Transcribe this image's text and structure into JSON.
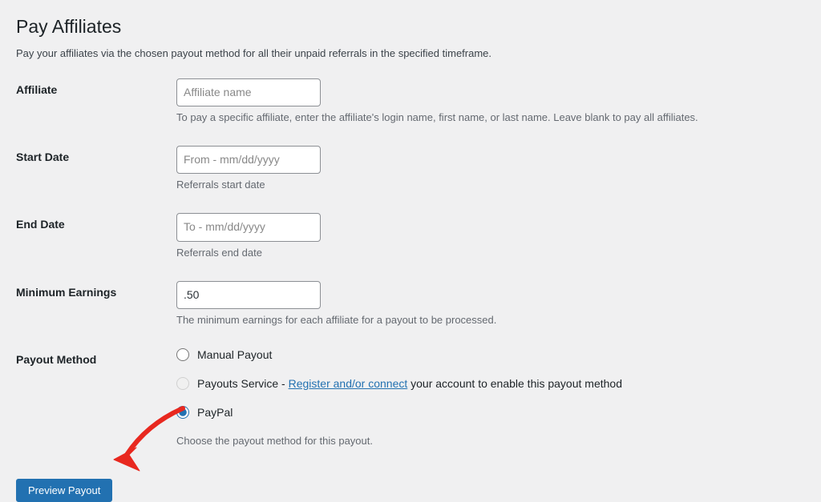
{
  "page": {
    "title": "Pay Affiliates",
    "description": "Pay your affiliates via the chosen payout method for all their unpaid referrals in the specified timeframe."
  },
  "fields": {
    "affiliate": {
      "label": "Affiliate",
      "placeholder": "Affiliate name",
      "value": "",
      "description": "To pay a specific affiliate, enter the affiliate's login name, first name, or last name. Leave blank to pay all affiliates."
    },
    "start_date": {
      "label": "Start Date",
      "placeholder": "From - mm/dd/yyyy",
      "value": "",
      "description": "Referrals start date"
    },
    "end_date": {
      "label": "End Date",
      "placeholder": "To - mm/dd/yyyy",
      "value": "",
      "description": "Referrals end date"
    },
    "minimum_earnings": {
      "label": "Minimum Earnings",
      "value": ".50",
      "description": "The minimum earnings for each affiliate for a payout to be processed."
    },
    "payout_method": {
      "label": "Payout Method",
      "options": {
        "manual": "Manual Payout",
        "payouts_service_prefix": "Payouts Service - ",
        "payouts_service_link": "Register and/or connect",
        "payouts_service_suffix": " your account to enable this payout method",
        "paypal": "PayPal"
      },
      "selected": "paypal",
      "description": "Choose the payout method for this payout."
    }
  },
  "buttons": {
    "preview": "Preview Payout"
  }
}
